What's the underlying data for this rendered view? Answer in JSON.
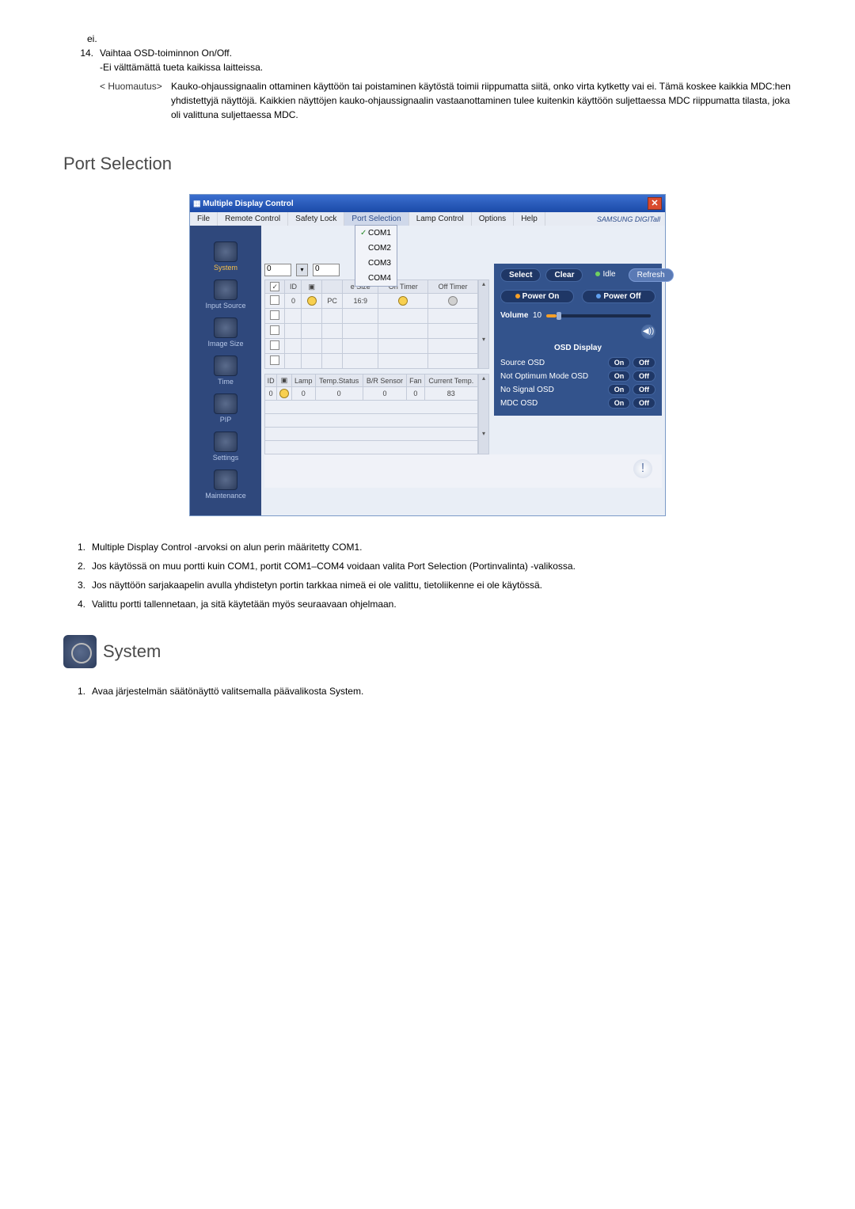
{
  "intro": {
    "ei": "ei.",
    "item14_num": "14.",
    "item14_text": "Vaihtaa OSD-toiminnon On/Off.",
    "item14_sub": "-Ei välttämättä tueta kaikissa laitteissa.",
    "note_label": "< Huomautus>",
    "note_text": "Kauko-ohjaussignaalin ottaminen käyttöön tai poistaminen käytöstä toimii riippumatta siitä, onko virta kytketty vai ei. Tämä koskee kaikkia MDC:hen yhdistettyjä näyttöjä. Kaikkien näyttöjen kauko-ohjaussignaalin vastaanottaminen tulee kuitenkin käyttöön suljettaessa MDC riippumatta tilasta, joka oli valittuna suljettaessa MDC."
  },
  "section1_title": "Port Selection",
  "app": {
    "title": "Multiple Display Control",
    "brand": "SAMSUNG DIGITall",
    "menus": [
      "File",
      "Remote Control",
      "Safety Lock",
      "Port Selection",
      "Lamp Control",
      "Options",
      "Help"
    ],
    "ports": [
      "COM1",
      "COM2",
      "COM3",
      "COM4"
    ],
    "sidebar": [
      {
        "label": "System",
        "active": true
      },
      {
        "label": "Input Source"
      },
      {
        "label": "Image Size"
      },
      {
        "label": "Time"
      },
      {
        "label": "PIP"
      },
      {
        "label": "Settings"
      },
      {
        "label": "Maintenance"
      }
    ],
    "toolbar": {
      "val0a": "0",
      "val0b": "0",
      "select": "Select",
      "clear": "Clear",
      "idle": "Idle",
      "refresh": "Refresh",
      "power_on": "Power On",
      "power_off": "Power Off"
    },
    "grid1": {
      "headers": [
        "",
        "ID",
        "",
        "",
        "e Size",
        "On Timer",
        "Off Timer"
      ],
      "row": {
        "id": "0",
        "src": "PC",
        "size": "16:9"
      }
    },
    "grid2": {
      "headers": [
        "ID",
        "",
        "Lamp",
        "Temp.Status",
        "B/R Sensor",
        "Fan",
        "Current Temp."
      ],
      "row": {
        "id": "0",
        "lamp": "0",
        "temp_s": "0",
        "br": "0",
        "fan": "0",
        "ctemp": "83"
      }
    },
    "volume": {
      "label": "Volume",
      "value": "10"
    },
    "osd": {
      "title": "OSD Display",
      "rows": [
        "Source OSD",
        "Not Optimum Mode OSD",
        "No Signal OSD",
        "MDC OSD"
      ],
      "on": "On",
      "off": "Off"
    }
  },
  "list1": [
    "Multiple Display Control -arvoksi on alun perin määritetty COM1.",
    "Jos käytössä on muu portti kuin COM1, portit COM1–COM4 voidaan valita Port Selection (Portinvalinta) -valikossa.",
    "Jos näyttöön sarjakaapelin avulla yhdistetyn portin tarkkaa nimeä ei ole valittu, tietoliikenne ei ole käytössä.",
    "Valittu portti tallennetaan, ja sitä käytetään myös seuraavaan ohjelmaan."
  ],
  "section2_title": "System",
  "list2": [
    "Avaa järjestelmän säätönäyttö valitsemalla päävalikosta System."
  ]
}
